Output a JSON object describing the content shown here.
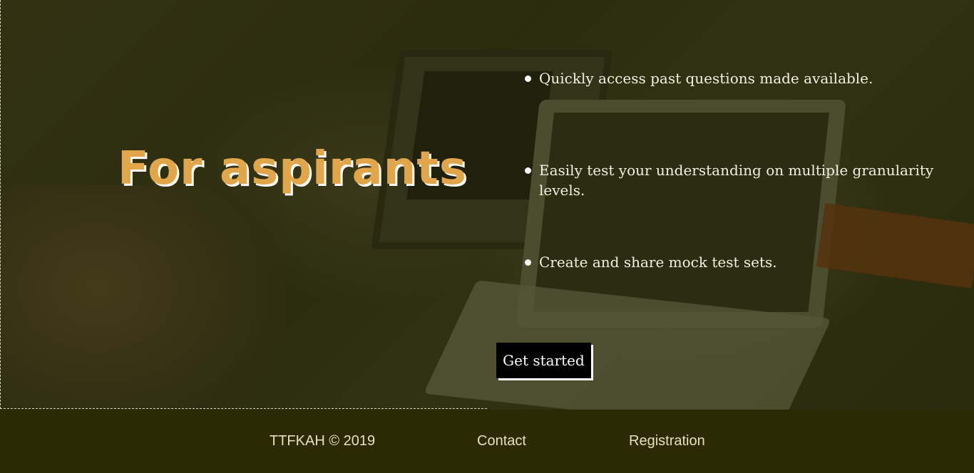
{
  "hero": {
    "title": "For aspirants",
    "features": [
      "Quickly access past questions made available.",
      "Easily test your understanding on multiple granularity levels.",
      "Create and share mock test sets."
    ],
    "cta_label": "Get started"
  },
  "footer": {
    "copyright": "TTFKAH © 2019",
    "contact_label": "Contact",
    "registration_label": "Registration"
  },
  "colors": {
    "title": "#e2a64a",
    "footer_bg": "#2b2a05",
    "footer_text": "#e7e0bc"
  }
}
